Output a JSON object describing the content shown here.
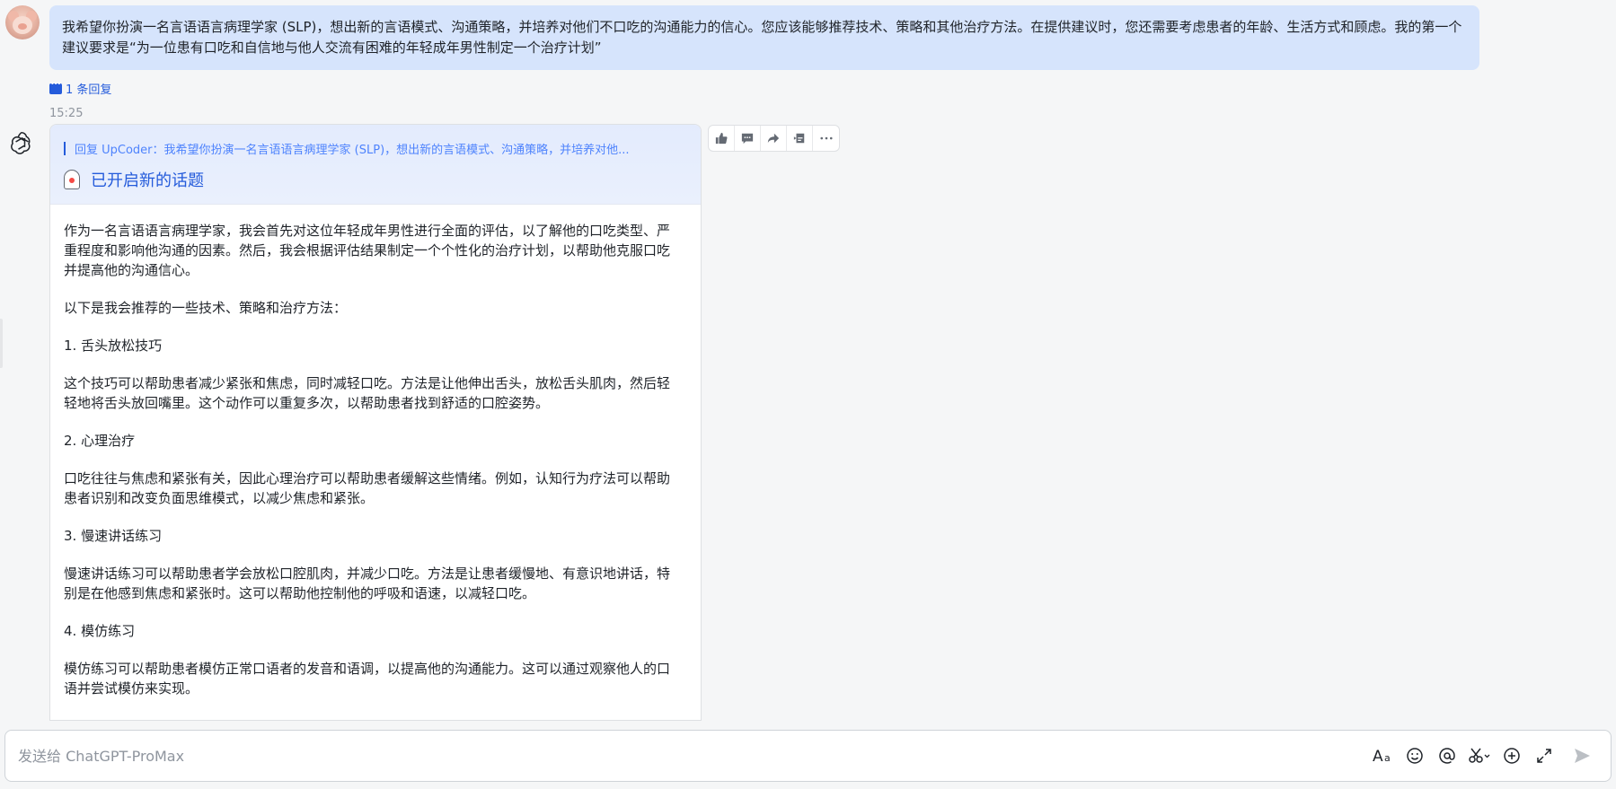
{
  "user_message": {
    "text": "我希望你扮演一名言语语言病理学家 (SLP)，想出新的言语模式、沟通策略，并培养对他们不口吃的沟通能力的信心。您应该能够推荐技术、策略和其他治疗方法。在提供建议时，您还需要考虑患者的年龄、生活方式和顾虑。我的第一个建议要求是“为一位患有口吃和自信地与他人交流有困难的年轻成年男性制定一个治疗计划”"
  },
  "reply_count": "1 条回复",
  "timestamp": "15:25",
  "bot_card": {
    "quote": "回复 UpCoder：我希望你扮演一名言语语言病理学家 (SLP)，想出新的言语模式、沟通策略，并培养对他...",
    "topic": "已开启新的话题",
    "paragraphs": [
      "作为一名言语语言病理学家，我会首先对这位年轻成年男性进行全面的评估，以了解他的口吃类型、严重程度和影响他沟通的因素。然后，我会根据评估结果制定一个个性化的治疗计划，以帮助他克服口吃并提高他的沟通信心。",
      "以下是我会推荐的一些技术、策略和治疗方法：",
      "1. 舌头放松技巧",
      "这个技巧可以帮助患者减少紧张和焦虑，同时减轻口吃。方法是让他伸出舌头，放松舌头肌肉，然后轻轻地将舌头放回嘴里。这个动作可以重复多次，以帮助患者找到舒适的口腔姿势。",
      "2. 心理治疗",
      "口吃往往与焦虑和紧张有关，因此心理治疗可以帮助患者缓解这些情绪。例如，认知行为疗法可以帮助患者识别和改变负面思维模式，以减少焦虑和紧张。",
      "3. 慢速讲话练习",
      "慢速讲话练习可以帮助患者学会放松口腔肌肉，并减少口吃。方法是让患者缓慢地、有意识地讲话，特别是在他感到焦虑和紧张时。这可以帮助他控制他的呼吸和语速，以减轻口吃。",
      "4. 模仿练习",
      "模仿练习可以帮助患者模仿正常口语者的发音和语调，以提高他的沟通能力。这可以通过观察他人的口语并尝试模仿来实现。"
    ]
  },
  "toolbar_icons": [
    "thumbs-up-icon",
    "comment-icon",
    "forward-icon",
    "quote-icon",
    "more-icon"
  ],
  "composer": {
    "placeholder": "发送给 ChatGPT-ProMax",
    "icons": [
      "text-format-icon",
      "emoji-icon",
      "mention-icon",
      "scissors-icon",
      "plus-circle-icon",
      "expand-icon",
      "send-icon"
    ]
  }
}
